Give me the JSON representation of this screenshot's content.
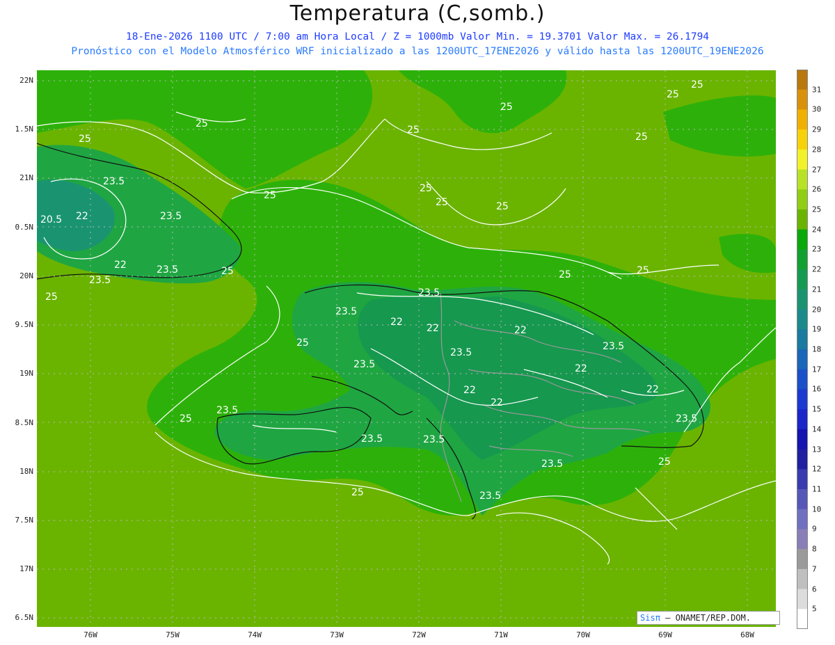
{
  "title": "Temperatura (C,somb.)",
  "subtitle_line1": "18-Ene-2026  1100 UTC / 7:00 am Hora Local / Z = 1000mb   Valor Min. = 19.3701  Valor Max. = 26.1794",
  "subtitle_line2": "Pronóstico con el Modelo Atmosférico WRF inicializado a las 1200UTC_17ENE2026 y válido hasta las  1200UTC_19ENE2026",
  "lat_labels": [
    "22N",
    "1.5N",
    "21N",
    "0.5N",
    "20N",
    "9.5N",
    "19N",
    "8.5N",
    "18N",
    "7.5N",
    "17N",
    "6.5N"
  ],
  "lon_labels": [
    "76W",
    "75W",
    "74W",
    "73W",
    "72W",
    "71W",
    "70W",
    "69W",
    "68W"
  ],
  "colorbar": {
    "labels": [
      "31",
      "30",
      "29",
      "28",
      "27",
      "26",
      "25",
      "24",
      "23",
      "22",
      "21",
      "20",
      "19",
      "18",
      "17",
      "16",
      "15",
      "14",
      "13",
      "12",
      "11",
      "10",
      "9",
      "8",
      "7",
      "6",
      "5"
    ],
    "colors": [
      "#b8780a",
      "#d9910a",
      "#f0b000",
      "#f7d20a",
      "#f2f22a",
      "#b7e226",
      "#8fce14",
      "#6ab400",
      "#09a909",
      "#12a030",
      "#169a52",
      "#1a9470",
      "#1a8a8a",
      "#1a7aa0",
      "#1a66b8",
      "#1a50c8",
      "#1a3ad0",
      "#1a26c8",
      "#1414b0",
      "#2020a0",
      "#3b3bb0",
      "#5656b8",
      "#7070c0",
      "#8a7eb8",
      "#9a9a9a",
      "#bfbfbf",
      "#dcdcdc",
      "#ffffff"
    ]
  },
  "contour_labels": [
    "25",
    "25",
    "25",
    "25",
    "25",
    "25",
    "25",
    "25",
    "25",
    "25",
    "25",
    "25",
    "25",
    "25",
    "25",
    "25",
    "25",
    "25",
    "25",
    "23.5",
    "23.5",
    "23.5",
    "23.5",
    "23.5",
    "23.5",
    "23.5",
    "23.5",
    "23.5",
    "23.5",
    "23.5",
    "23.5",
    "23.5",
    "23.5",
    "23.5",
    "22",
    "22",
    "22",
    "22",
    "22",
    "22",
    "22",
    "22",
    "22",
    "20.5"
  ],
  "brand": {
    "sis": "Sis",
    "pi": "π",
    "rest": "– ONAMET/REP.DOM."
  }
}
